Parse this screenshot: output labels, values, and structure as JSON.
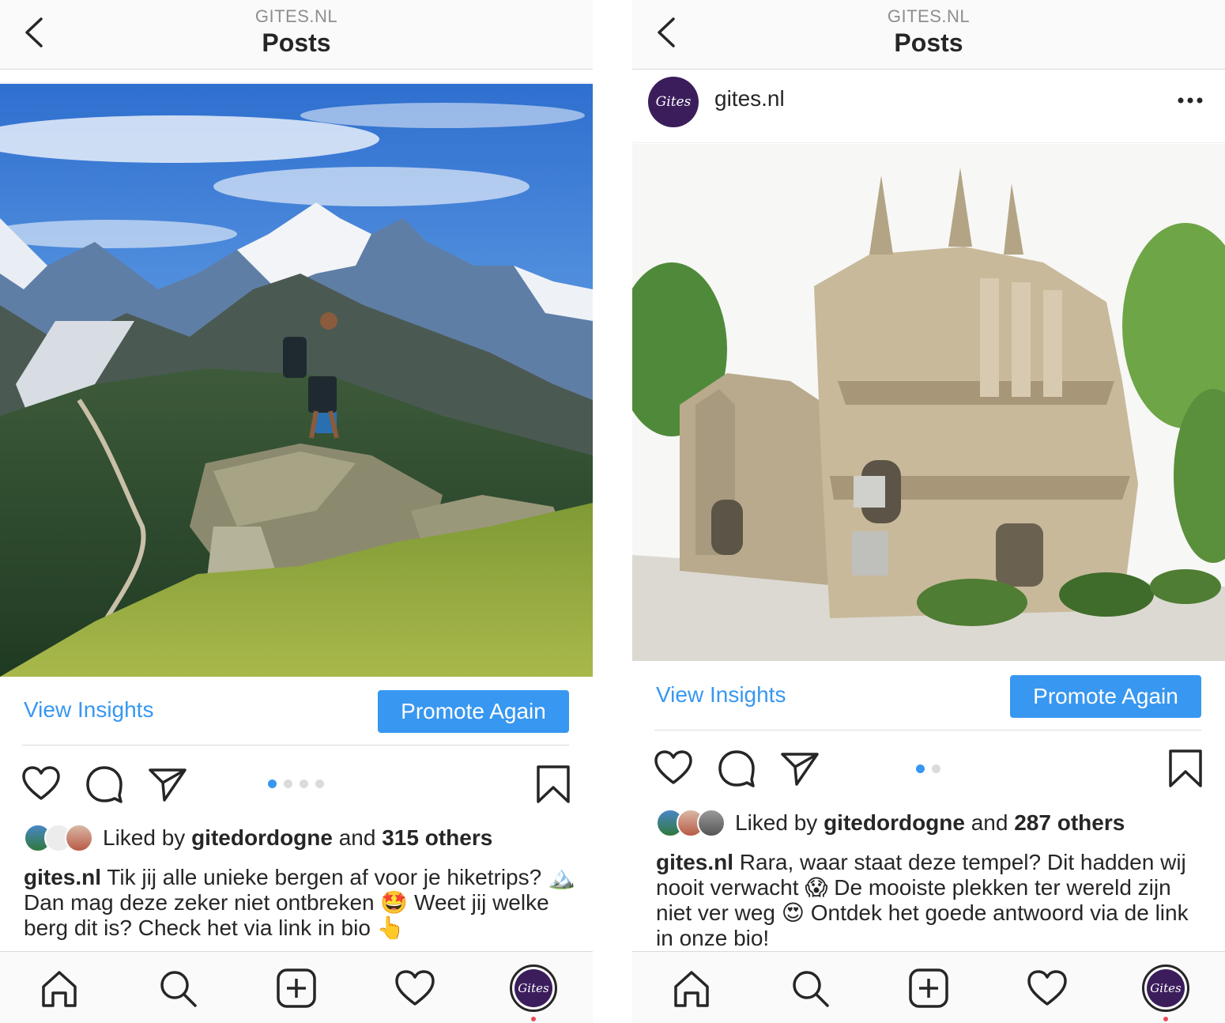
{
  "colors": {
    "accent": "#3897f0",
    "brand_purple": "#3b1d5c",
    "text": "#262626",
    "muted": "#8e8e8e",
    "divider": "#dbdbdb"
  },
  "screens": [
    {
      "header": {
        "subtitle": "GITES.NL",
        "title": "Posts",
        "back_icon": "chevron-left-icon"
      },
      "post": {
        "image_alt": "hiker standing on a rock in front of snowy mountains",
        "insights_label": "View Insights",
        "promote_label": "Promote Again",
        "carousel": {
          "count": 4,
          "active": 1
        },
        "likes": {
          "prefix": "Liked by",
          "user": "gitedordogne",
          "conj": "and",
          "count": "315 others"
        },
        "caption": {
          "user": "gites.nl",
          "text": " Tik jij alle unieke bergen af voor je hiketrips? 🏔️ Dan mag deze zeker niet ontbreken 🤩 Weet jij welke berg dit is? Check het via link in bio 👆"
        }
      }
    },
    {
      "header": {
        "subtitle": "GITES.NL",
        "title": "Posts",
        "back_icon": "chevron-left-icon"
      },
      "post": {
        "username": "gites.nl",
        "avatar_text": "Gites",
        "more_icon": "more-horizontal-icon",
        "image_alt": "ornate stone palace surrounded by trees",
        "insights_label": "View Insights",
        "promote_label": "Promote Again",
        "carousel": {
          "count": 2,
          "active": 1
        },
        "likes": {
          "prefix": "Liked by",
          "user": "gitedordogne",
          "conj": "and",
          "count": "287 others"
        },
        "caption": {
          "user": "gites.nl",
          "text": " Rara, waar staat deze tempel? Dit hadden wij nooit verwacht 😱 De mooiste plekken ter wereld zijn niet ver weg 😍 Ontdek het goede antwoord via de link in onze bio!"
        }
      }
    }
  ],
  "tabbar": {
    "icons": [
      "home-icon",
      "search-icon",
      "new-post-icon",
      "activity-heart-icon",
      "profile-avatar"
    ],
    "profile_text": "Gites"
  }
}
